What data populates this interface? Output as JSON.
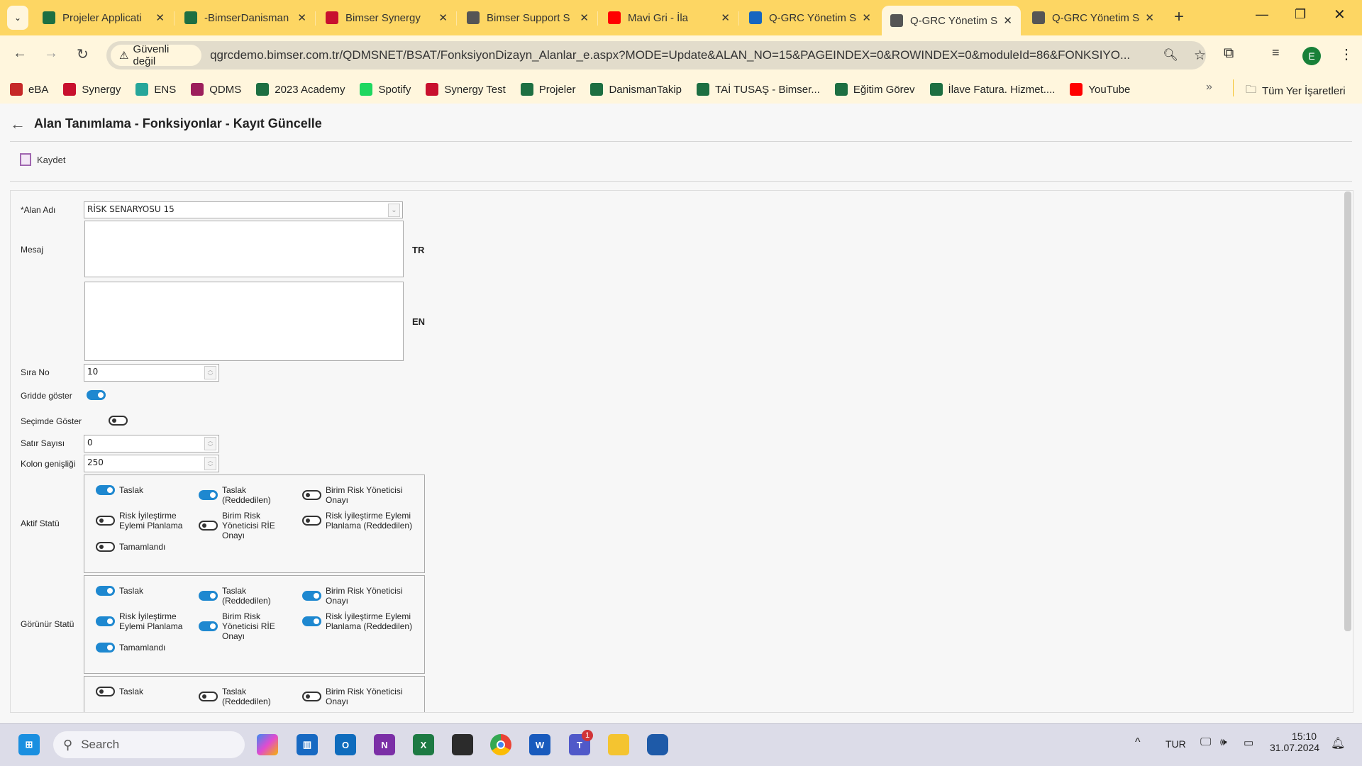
{
  "browser": {
    "tabs": [
      {
        "title": "Projeler Applicati",
        "icon": "excel-icon",
        "color": "#1d6f42"
      },
      {
        "title": "-BimserDanisman",
        "icon": "excel-icon",
        "color": "#1d6f42"
      },
      {
        "title": "Bimser Synergy",
        "icon": "synergy-icon",
        "color": "#c8102e"
      },
      {
        "title": "Bimser Support S",
        "icon": "globe-icon",
        "color": "#555555"
      },
      {
        "title": "Mavi Gri - İla",
        "icon": "youtube-icon",
        "color": "#ff0000"
      },
      {
        "title": "Q-GRC Yönetim S",
        "icon": "qgrc-icon",
        "color": "#1565c0"
      },
      {
        "title": "Q-GRC Yönetim S",
        "icon": "globe-icon",
        "color": "#555555",
        "active": true
      },
      {
        "title": "Q-GRC Yönetim S",
        "icon": "globe-icon",
        "color": "#555555"
      }
    ],
    "security_label": "Güvenli değil",
    "url": "qgrcdemo.bimser.com.tr/QDMSNET/BSAT/FonksiyonDizayn_Alanlar_e.aspx?MODE=Update&ALAN_NO=15&PAGEINDEX=0&ROWINDEX=0&moduleId=86&FONKSIYO...",
    "profile_initial": "E",
    "bookmarks": [
      {
        "label": "eBA",
        "color": "#c62828"
      },
      {
        "label": "Synergy",
        "color": "#c8102e"
      },
      {
        "label": "ENS",
        "color": "#26a69a"
      },
      {
        "label": "QDMS",
        "color": "#9c1f5c"
      },
      {
        "label": "2023 Academy",
        "color": "#1d6f42"
      },
      {
        "label": "Spotify",
        "color": "#1ed760"
      },
      {
        "label": "Synergy Test",
        "color": "#c8102e"
      },
      {
        "label": "Projeler",
        "color": "#1d6f42"
      },
      {
        "label": "DanismanTakip",
        "color": "#1d6f42"
      },
      {
        "label": "TAİ TUSAŞ - Bimser...",
        "color": "#1d6f42"
      },
      {
        "label": "Eğitim Görev",
        "color": "#1d6f42"
      },
      {
        "label": "İlave Fatura. Hizmet....",
        "color": "#1d6f42"
      },
      {
        "label": "YouTube",
        "color": "#ff0000"
      }
    ],
    "all_bookmarks_label": "Tüm Yer İşaretleri"
  },
  "page": {
    "title": "Alan Tanımlama - Fonksiyonlar - Kayıt Güncelle",
    "save_label": "Kaydet",
    "form": {
      "alan_adi_label": "*Alan Adı",
      "alan_adi_value": "RİSK SENARYOSU  15",
      "mesaj_label": "Mesaj",
      "tr_label": "TR",
      "en_label": "EN",
      "mesaj_tr": "",
      "mesaj_en": "",
      "sira_no_label": "Sıra No",
      "sira_no_value": "10",
      "gridde_label": "Gridde göster",
      "gridde_on": true,
      "secimde_label": "Seçimde Göster",
      "secimde_on": false,
      "satir_label": "Satır Sayısı",
      "satir_value": "0",
      "kolon_label": "Kolon genişliği",
      "kolon_value": "250",
      "aktif_label": "Aktif Statü",
      "gorunur_label": "Görünür Statü",
      "status_options": [
        "Taslak",
        "Taslak (Reddedilen)",
        "Birim Risk Yöneticisi Onayı",
        "Risk İyileştirme Eylemi Planlama",
        "Birim Risk Yöneticisi RİE Onayı",
        "Risk İyileştirme Eylemi Planlama (Reddedilen)",
        "Tamamlandı"
      ],
      "aktif_states": [
        true,
        true,
        false,
        false,
        false,
        false,
        false
      ],
      "gorunur_states": [
        true,
        true,
        true,
        true,
        true,
        true,
        true
      ],
      "third_states": [
        false,
        false,
        false
      ]
    }
  },
  "taskbar": {
    "search_placeholder": "Search",
    "language": "TUR",
    "time": "15:10",
    "date": "31.07.2024",
    "teams_badge": "1"
  }
}
